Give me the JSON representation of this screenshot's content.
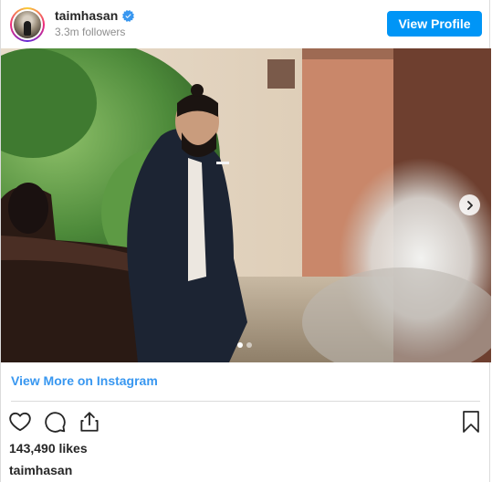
{
  "header": {
    "username": "taimhasan",
    "followers": "3.3m followers",
    "view_profile_label": "View Profile"
  },
  "post": {
    "view_more_label": "View More on Instagram",
    "likes": "143,490 likes",
    "caption_username": "taimhasan",
    "carousel_total": 2,
    "carousel_current": 1
  },
  "colors": {
    "accent": "#0095f6",
    "link": "#3897f0",
    "text": "#262626",
    "muted": "#8e8e8e"
  },
  "icons": {
    "verified": "verified-badge-icon",
    "next": "chevron-right-icon",
    "like": "heart-icon",
    "comment": "comment-icon",
    "share": "share-icon",
    "save": "bookmark-icon"
  }
}
